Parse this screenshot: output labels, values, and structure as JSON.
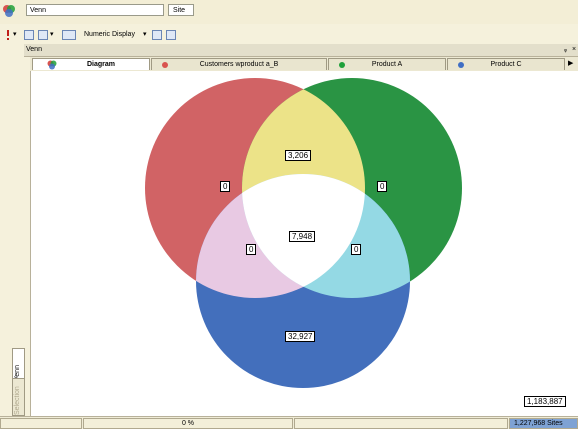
{
  "window": {
    "name_value": "Venn",
    "site_label": "Site"
  },
  "toolbar": {
    "numeric_display_label": "Numeric Display"
  },
  "panel": {
    "title": "Venn",
    "pin_glyph": "ᵩ",
    "close_glyph": "×"
  },
  "tabs": [
    {
      "label": "Diagram",
      "dot_color": ""
    },
    {
      "label": "Customers wproduct a_B",
      "dot_color": "#d9534f"
    },
    {
      "label": "Product A",
      "dot_color": "#1fa03a"
    },
    {
      "label": "Product C",
      "dot_color": "#3f6ec4"
    }
  ],
  "side_tabs": {
    "venn": "Venn",
    "selection": "Selection"
  },
  "venn": {
    "sets": [
      {
        "color": "#d16365"
      },
      {
        "color": "#2a9444"
      },
      {
        "color": "#436fbc"
      }
    ],
    "intersection_colors": {
      "red_green": "#ece388",
      "red_blue": "#e8c9e3",
      "green_blue": "#94d9e4",
      "all": "#ffffff"
    },
    "values": {
      "red_only": "0",
      "green_only": "0",
      "blue_only": "32,927",
      "red_green": "3,206",
      "red_blue": "0",
      "green_blue": "0",
      "all": "7,948"
    },
    "outside_total": "1,183,887"
  },
  "status": {
    "percent": "0 %",
    "sites": "1,227,968 Sites"
  }
}
